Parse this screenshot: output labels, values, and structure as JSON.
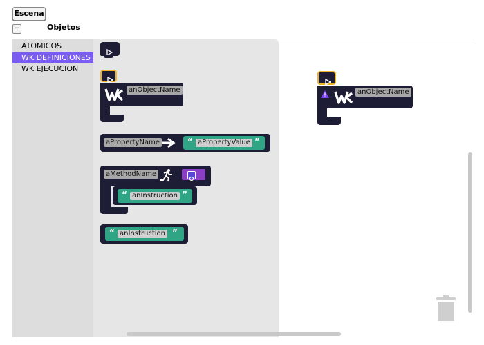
{
  "top": {
    "scene_button": "Escena",
    "add_button": "+",
    "objects_label": "Objetos"
  },
  "toolbox": {
    "categories": [
      {
        "label": "ATOMICOS",
        "selected": false
      },
      {
        "label": "WK DEFINICIONES",
        "selected": true
      },
      {
        "label": "WK EJECUCION",
        "selected": false
      }
    ],
    "accent_color": "#7a5cf0"
  },
  "flyout": {
    "object_block": {
      "field": "anObjectName"
    },
    "property_block": {
      "name": "aPropertyName",
      "value": "aPropertyValue"
    },
    "method_block": {
      "name": "aMethodName",
      "instruction": "anInstruction"
    },
    "instruction_block": {
      "value": "anInstruction"
    },
    "open_quote": "“",
    "close_quote": "”",
    "block_color": "#1d1d36",
    "string_color": "#2fa585",
    "hat_outline_color": "#f0b428"
  },
  "canvas": {
    "object_block": {
      "field": "anObjectName",
      "warning": true
    }
  },
  "icons": {
    "play": "play-icon",
    "logo": "wk-logo-icon",
    "arrow": "arrow-right-icon",
    "run": "running-man-icon",
    "gear": "gear-icon",
    "warning": "warning-icon",
    "trash": "trash-icon"
  }
}
